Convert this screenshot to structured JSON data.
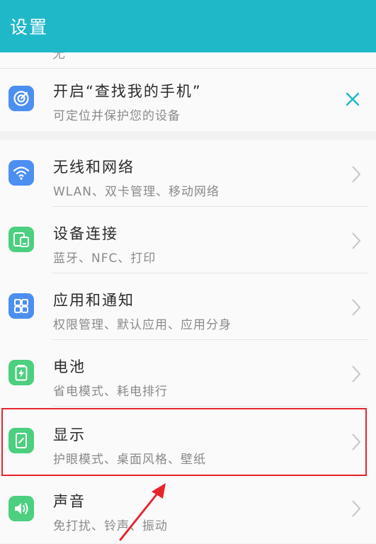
{
  "app_bar": {
    "title": "设置"
  },
  "partial_row": {
    "text": "无"
  },
  "find_phone": {
    "title": "开启“查找我的手机”",
    "subtitle": "可定位并保护您的设备",
    "icon": "radar-target-icon",
    "close_icon": "close-icon"
  },
  "settings": {
    "items": [
      {
        "title": "无线和网络",
        "subtitle": "WLAN、双卡管理、移动网络",
        "icon": "wifi-icon",
        "color": "#4d8ff0"
      },
      {
        "title": "设备连接",
        "subtitle": "蓝牙、NFC、打印",
        "icon": "device-connect-icon",
        "color": "#4ccf7f"
      },
      {
        "title": "应用和通知",
        "subtitle": "权限管理、默认应用、应用分身",
        "icon": "apps-grid-icon",
        "color": "#4d8ff0"
      },
      {
        "title": "电池",
        "subtitle": "省电模式、耗电排行",
        "icon": "battery-icon",
        "color": "#4ccf7f"
      },
      {
        "title": "显示",
        "subtitle": "护眼模式、桌面风格、壁纸",
        "icon": "display-icon",
        "color": "#4ccf7f"
      },
      {
        "title": "声音",
        "subtitle": "免打扰、铃声、振动",
        "icon": "speaker-icon",
        "color": "#4ccf7f"
      }
    ]
  },
  "annotation": {
    "highlight_color": "#e8242b"
  },
  "colors": {
    "accent": "#1fb8c9",
    "chevron": "#c4c4c4"
  }
}
